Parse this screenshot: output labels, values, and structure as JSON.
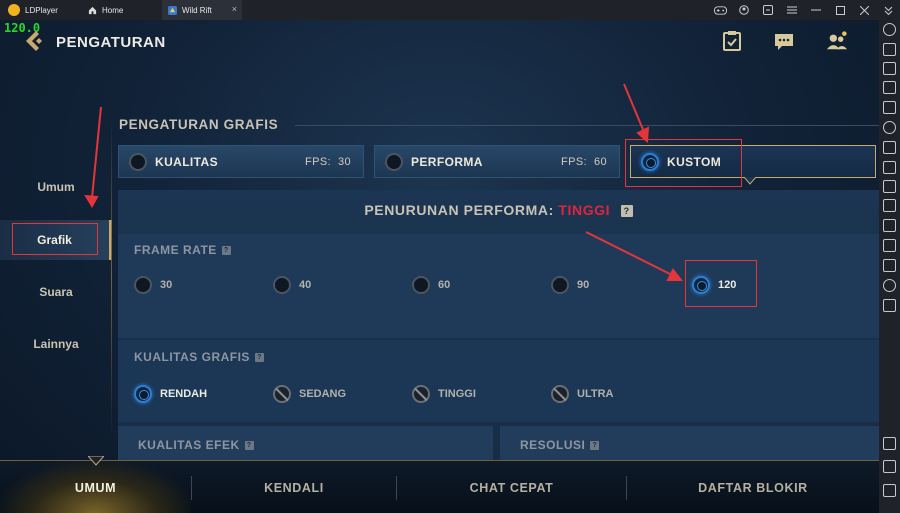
{
  "titlebar": {
    "app_name": "LDPlayer",
    "tabs": [
      {
        "label": "Home",
        "icon": "home-icon"
      },
      {
        "label": "Wild Rift",
        "icon": "game-icon",
        "close": "×"
      }
    ],
    "controls": [
      "gamepad-icon",
      "account-icon",
      "settings-icon",
      "menu-icon",
      "minimize-icon",
      "maximize-icon",
      "close-icon",
      "collapse-icon"
    ]
  },
  "game": {
    "fps_overlay": "120.0",
    "page_title": "PENGATURAN",
    "categories": [
      {
        "label": "Umum",
        "selected": false
      },
      {
        "label": "Grafik",
        "selected": true
      },
      {
        "label": "Suara",
        "selected": false
      },
      {
        "label": "Lainnya",
        "selected": false
      }
    ],
    "graphics_title": "PENGATURAN GRAFIS",
    "presets": [
      {
        "label": "KUALITAS",
        "fps_label": "FPS:",
        "fps_value": "30",
        "selected": false
      },
      {
        "label": "PERFORMA",
        "fps_label": "FPS:",
        "fps_value": "60",
        "selected": false
      },
      {
        "label": "KUSTOM",
        "selected": true
      }
    ],
    "performance_drop_label": "PENURUNAN PERFORMA:",
    "performance_drop_level": "TINGGI",
    "help_mark": "?",
    "frame_rate": {
      "label": "FRAME RATE",
      "options": [
        "30",
        "40",
        "60",
        "90",
        "120"
      ],
      "selected": "120"
    },
    "graphics_quality": {
      "label": "KUALITAS GRAFIS",
      "options": [
        {
          "label": "RENDAH",
          "state": "selected"
        },
        {
          "label": "SEDANG",
          "state": "disabled"
        },
        {
          "label": "TINGGI",
          "state": "disabled"
        },
        {
          "label": "ULTRA",
          "state": "disabled"
        }
      ]
    },
    "effect_quality_label": "KUALITAS EFEK",
    "resolution_label": "RESOLUSI",
    "bottom_tabs": [
      {
        "label": "UMUM",
        "active": true
      },
      {
        "label": "KENDALI",
        "active": false
      },
      {
        "label": "CHAT CEPAT",
        "active": false
      },
      {
        "label": "DAFTAR BLOKIR",
        "active": false
      }
    ]
  },
  "colors": {
    "accent_gold": "#c8aa6e",
    "radio_selected": "#2a7fd2",
    "warning_red": "#e0253b",
    "annotation_red": "#e3353a",
    "fps_green": "#28d828"
  }
}
